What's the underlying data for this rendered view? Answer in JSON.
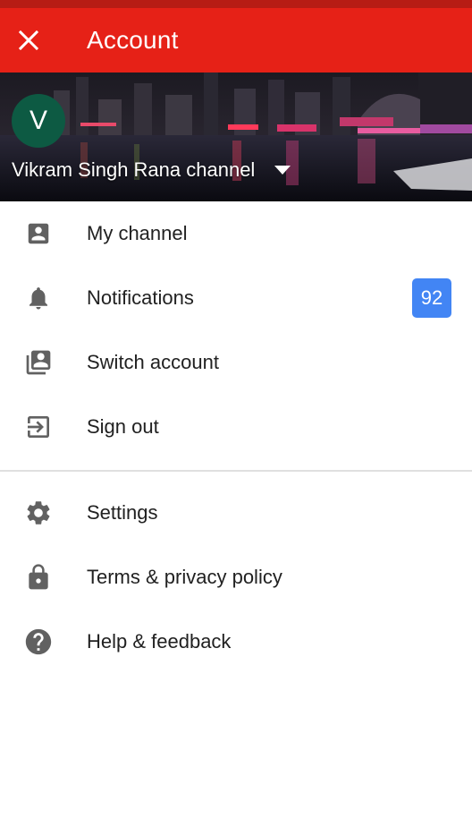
{
  "header": {
    "title": "Account",
    "bar_color": "#e62117"
  },
  "profile": {
    "avatar_letter": "V",
    "avatar_color": "#0d5a43",
    "channel_name": "Vikram Singh Rana channel"
  },
  "menu_primary": [
    {
      "label": "My channel",
      "icon": "account-box-icon"
    },
    {
      "label": "Notifications",
      "icon": "bell-icon",
      "badge": "92"
    },
    {
      "label": "Switch account",
      "icon": "switch-account-icon"
    },
    {
      "label": "Sign out",
      "icon": "exit-icon"
    }
  ],
  "menu_secondary": [
    {
      "label": "Settings",
      "icon": "gear-icon"
    },
    {
      "label": "Terms & privacy policy",
      "icon": "lock-icon"
    },
    {
      "label": "Help & feedback",
      "icon": "help-icon"
    }
  ],
  "colors": {
    "badge": "#4285f4",
    "icon": "#616161"
  }
}
